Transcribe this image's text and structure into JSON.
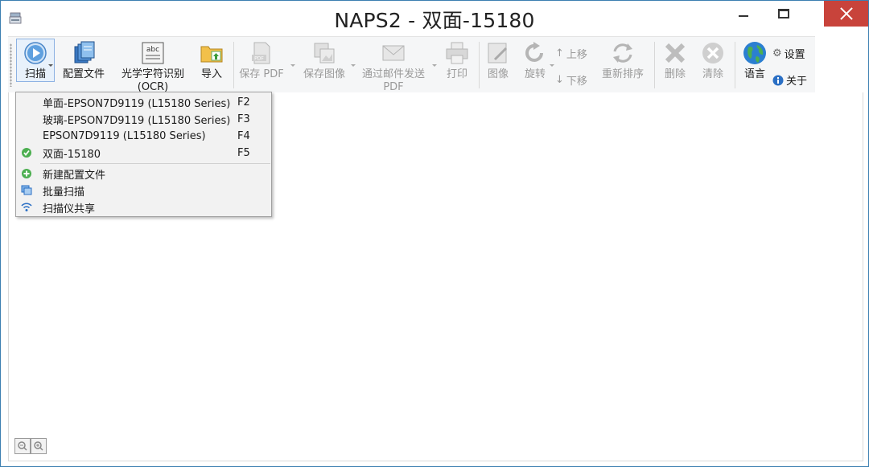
{
  "window": {
    "title": "NAPS2 - 双面-15180"
  },
  "toolbar": {
    "scan": "扫描",
    "profiles": "配置文件",
    "ocr_line1": "光学字符识别",
    "ocr_line2": "(OCR)",
    "import": "导入",
    "save_pdf": "保存 PDF",
    "save_image": "保存图像",
    "email_line1": "通过邮件发送",
    "email_line2": "PDF",
    "print": "打印",
    "image": "图像",
    "rotate": "旋转",
    "move_up": "上移",
    "move_down": "下移",
    "reorder": "重新排序",
    "delete": "删除",
    "clear": "清除",
    "language": "语言",
    "settings": "设置",
    "about": "关于"
  },
  "scan_menu": {
    "profiles": [
      {
        "label": "单面-EPSON7D9119 (L15180 Series)",
        "shortcut": "F2",
        "selected": false
      },
      {
        "label": "玻璃-EPSON7D9119 (L15180 Series)",
        "shortcut": "F3",
        "selected": false
      },
      {
        "label": "EPSON7D9119 (L15180 Series)",
        "shortcut": "F4",
        "selected": false
      },
      {
        "label": "双面-15180",
        "shortcut": "F5",
        "selected": true
      }
    ],
    "new_profile": "新建配置文件",
    "batch_scan": "批量扫描",
    "scanner_sharing": "扫描仪共享"
  },
  "colors": {
    "accent": "#2a7fd4",
    "close_button": "#c8433b",
    "disabled_text": "#9a9a9a",
    "menu_bg": "#f2f2f2"
  }
}
